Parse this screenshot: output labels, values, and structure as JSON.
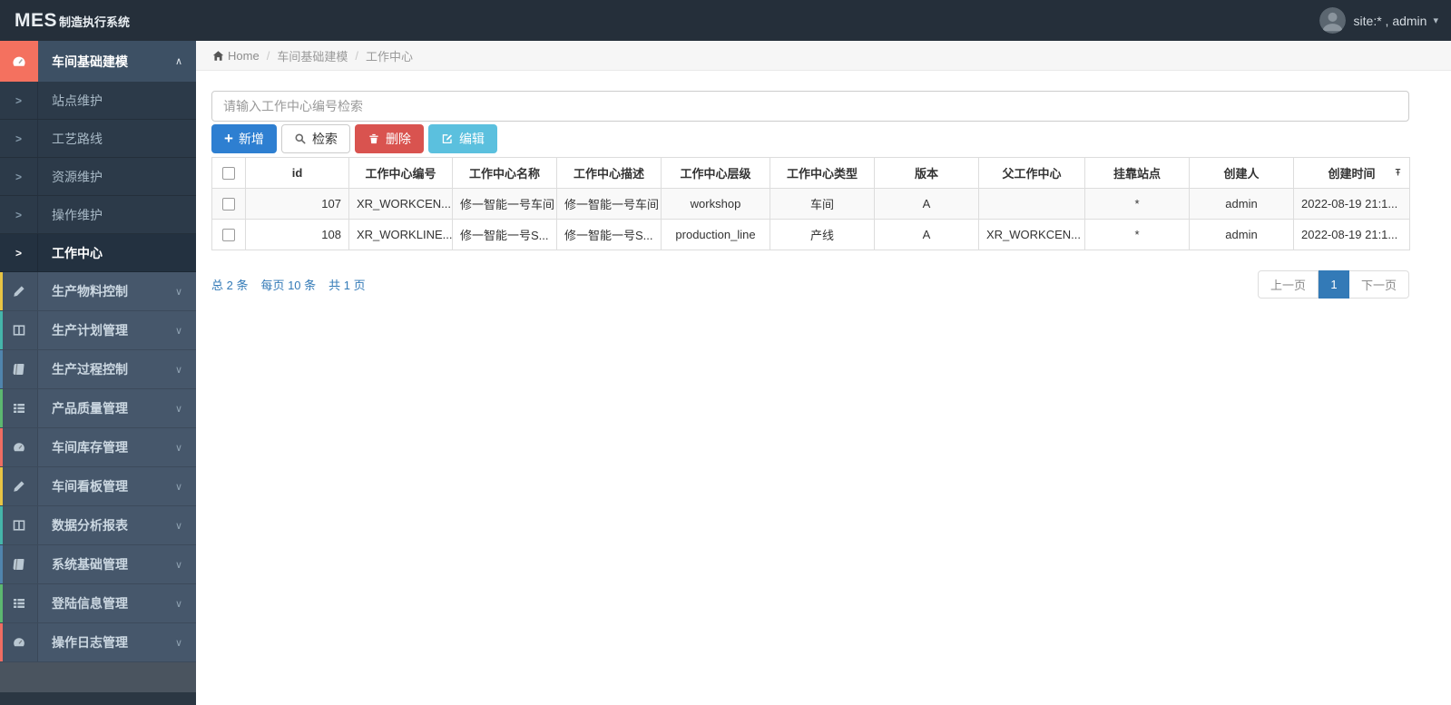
{
  "theme": {
    "navbar_bg": "#252f3a",
    "submenu_bg": "#2c3a49",
    "parent_bg": "#46576b",
    "active_icon_bg": "#f4715f",
    "primary_blue": "#2e7fd1",
    "danger_red": "#d9534f",
    "info_cyan": "#5bc0de",
    "link_blue": "#337ab7"
  },
  "navbar": {
    "brand_bold": "MES",
    "brand_rest": "制造执行系统",
    "user_label": "site:* , admin",
    "user_caret": "▾"
  },
  "breadcrumb": {
    "home": "Home",
    "sep": "/",
    "level1": "车间基础建模",
    "level2": "工作中心"
  },
  "sidebar": {
    "active_parent": {
      "label": "车间基础建模",
      "icon": "gauge-icon",
      "icon_bg": "#f4715f",
      "caret": "∧"
    },
    "sub_arrow": ">",
    "sub_items": [
      {
        "label": "站点维护"
      },
      {
        "label": "工艺路线"
      },
      {
        "label": "资源维护"
      },
      {
        "label": "操作维护"
      },
      {
        "label": "工作中心"
      }
    ],
    "parent_caret": "∨",
    "parents": [
      {
        "label": "生产物料控制",
        "icon": "pencil-icon",
        "strip": "#e8c444"
      },
      {
        "label": "生产计划管理",
        "icon": "columns-icon",
        "strip": "#45b5aa"
      },
      {
        "label": "生产过程控制",
        "icon": "book-icon",
        "strip": "#5084ad"
      },
      {
        "label": "产品质量管理",
        "icon": "list-icon",
        "strip": "#5cb870"
      },
      {
        "label": "车间库存管理",
        "icon": "gauge-icon",
        "strip": "#ef6d62"
      },
      {
        "label": "车间看板管理",
        "icon": "pencil-icon",
        "strip": "#e8c444"
      },
      {
        "label": "数据分析报表",
        "icon": "columns-icon",
        "strip": "#45b5aa"
      },
      {
        "label": "系统基础管理",
        "icon": "book-icon",
        "strip": "#5084ad"
      },
      {
        "label": "登陆信息管理",
        "icon": "list-icon",
        "strip": "#5cb870"
      },
      {
        "label": "操作日志管理",
        "icon": "gauge-icon",
        "strip": "#ef6d62"
      }
    ]
  },
  "toolbar": {
    "search_placeholder": "请输入工作中心编号检索",
    "add_label": "新增",
    "search_label": "检索",
    "delete_label": "删除",
    "edit_label": "编辑"
  },
  "table": {
    "columns": [
      "id",
      "工作中心编号",
      "工作中心名称",
      "工作中心描述",
      "工作中心层级",
      "工作中心类型",
      "版本",
      "父工作中心",
      "挂靠站点",
      "创建人",
      "创建时间"
    ],
    "rows": [
      {
        "cells": [
          "107",
          "XR_WORKCEN...",
          "修一智能一号车间",
          "修一智能一号车间",
          "workshop",
          "车间",
          "A",
          "",
          "*",
          "admin",
          "2022-08-19 21:1..."
        ]
      },
      {
        "cells": [
          "108",
          "XR_WORKLINE...",
          "修一智能一号S...",
          "修一智能一号S...",
          "production_line",
          "产线",
          "A",
          "XR_WORKCEN...",
          "*",
          "admin",
          "2022-08-19 21:1..."
        ]
      }
    ]
  },
  "pagination": {
    "total": "总 2 条",
    "per_page": "每页 10 条",
    "pages": "共 1 页",
    "prev": "上一页",
    "current": "1",
    "next": "下一页"
  }
}
